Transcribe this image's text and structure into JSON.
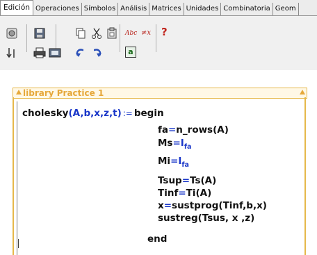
{
  "tabs": [
    {
      "label": "Edición",
      "active": true
    },
    {
      "label": "Operaciones",
      "active": false
    },
    {
      "label": "Símbolos",
      "active": false
    },
    {
      "label": "Análisis",
      "active": false
    },
    {
      "label": "Matrices",
      "active": false
    },
    {
      "label": "Unidades",
      "active": false
    },
    {
      "label": "Combinatoria",
      "active": false
    },
    {
      "label": "Geom",
      "active": false
    }
  ],
  "toolbar": {
    "icons": [
      "new-icon",
      "save-icon",
      "copy-icon",
      "cut-icon",
      "paste-icon",
      "spellcheck-icon",
      "find-replace-icon",
      "help-icon",
      "import-icon",
      "print-icon",
      "print-preview-icon",
      "undo-icon",
      "redo-icon",
      "equation-icon"
    ],
    "spell_label": "Abc",
    "replace_label": "≠x",
    "help_label": "?",
    "equation_label": "a"
  },
  "library": {
    "title": "library Practice 1"
  },
  "code": {
    "signature_name": "cholesky",
    "signature_args": "(A,b,x,z,t)",
    "define": ":=",
    "begin": "begin",
    "lines": [
      {
        "lhs": "fa",
        "eq": "=",
        "rhs": "n_rows(A)",
        "sub": ""
      },
      {
        "lhs": "Ms",
        "eq": "=",
        "rhs": "I",
        "sub": "fa"
      },
      {
        "lhs": "Mi",
        "eq": "=",
        "rhs": "I",
        "sub": "fa"
      },
      {
        "lhs": "Tsup",
        "eq": "=",
        "rhs": "Ts(A)",
        "sub": ""
      },
      {
        "lhs": "Tinf",
        "eq": "=",
        "rhs": "Ti(A)",
        "sub": ""
      },
      {
        "lhs": "x",
        "eq": "=",
        "rhs": "sustprog(Tinf,b,x)",
        "sub": ""
      },
      {
        "lhs": "",
        "eq": "",
        "rhs": "sustreg(Tsus, x ,z)",
        "sub": ""
      }
    ],
    "end": "end"
  }
}
